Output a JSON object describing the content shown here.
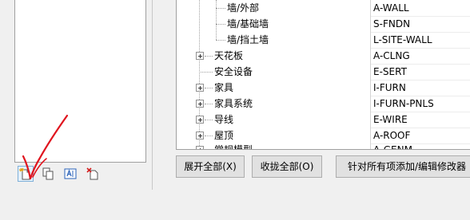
{
  "tree": {
    "rows": [
      {
        "name": "墙/外部",
        "code": "A-WALL",
        "expandable": false
      },
      {
        "name": "墙/基础墙",
        "code": "S-FNDN",
        "expandable": false
      },
      {
        "name": "墙/挡土墙",
        "code": "L-SITE-WALL",
        "expandable": false
      },
      {
        "name": "天花板",
        "code": "A-CLNG",
        "expandable": true
      },
      {
        "name": "安全设备",
        "code": "E-SERT",
        "expandable": false
      },
      {
        "name": "家具",
        "code": "I-FURN",
        "expandable": true
      },
      {
        "name": "家具系统",
        "code": "I-FURN-PNLS",
        "expandable": true
      },
      {
        "name": "导线",
        "code": "E-WIRE",
        "expandable": true
      },
      {
        "name": "屋顶",
        "code": "A-ROOF",
        "expandable": true
      },
      {
        "name": "常规模型",
        "code": "A-GENM",
        "expandable": true
      }
    ]
  },
  "buttons": {
    "expand_all": "展开全部(X)",
    "collapse_all": "收拢全部(O)",
    "add_edit_modifier": "针对所有项添加/编辑修改器"
  },
  "left_toolbar": {
    "icons": [
      "new-layer-icon",
      "copy-icon",
      "rename-icon",
      "delete-icon"
    ]
  },
  "colors": {
    "annotation": "#e0141e",
    "window_bg": "#f0f0f0",
    "list_bg": "#ffffff"
  }
}
